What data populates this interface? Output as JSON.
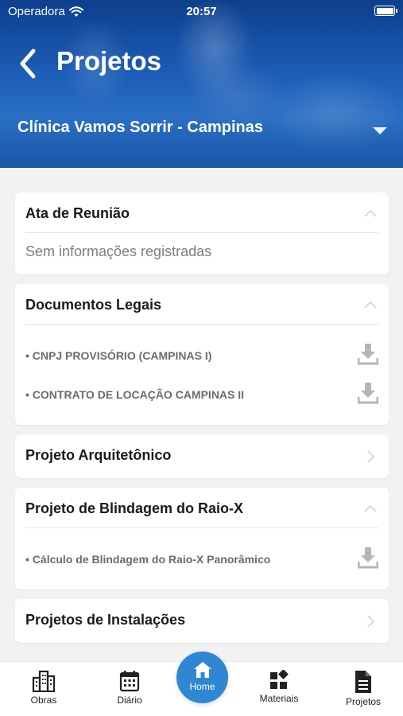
{
  "status_bar": {
    "carrier": "Operadora",
    "time": "20:57"
  },
  "header": {
    "title": "Projetos",
    "clinic": "Clínica Vamos Sorrir - Campinas"
  },
  "sections": [
    {
      "title": "Ata de Reunião",
      "expanded": true,
      "empty_text": "Sem informações registradas",
      "items": []
    },
    {
      "title": "Documentos Legais",
      "expanded": true,
      "items": [
        "• CNPJ PROVISÓRIO (CAMPINAS I)",
        "• CONTRATO DE LOCAÇÃO CAMPINAS II"
      ]
    },
    {
      "title": "Projeto Arquitetônico",
      "expanded": false,
      "items": []
    },
    {
      "title": "Projeto de Blindagem do Raio-X",
      "expanded": true,
      "items": [
        "• Cálculo de Blindagem do Raio-X Panorâmico"
      ]
    },
    {
      "title": "Projetos de Instalações",
      "expanded": false,
      "items": []
    }
  ],
  "nav": {
    "obras": "Obras",
    "diario": "Diário",
    "home": "Home",
    "materiais": "Materiais",
    "projetos": "Projetos"
  },
  "colors": {
    "header": "#1d5eb8",
    "home_button": "#2f86d2",
    "muted_icon": "#b5b5b5"
  },
  "icons": [
    "wifi-icon",
    "battery-icon",
    "back-arrow-icon",
    "caret-down-icon",
    "chevron-up-icon",
    "chevron-right-icon",
    "download-icon",
    "building-icon",
    "calendar-icon",
    "home-icon",
    "materials-icon",
    "document-icon"
  ]
}
